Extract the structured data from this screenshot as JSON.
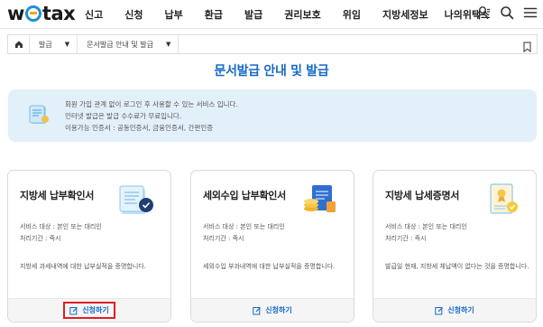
{
  "header": {
    "logo": {
      "prefix": "w",
      "suffix": "tax"
    },
    "nav": [
      "신고",
      "신청",
      "납부",
      "환급",
      "발급",
      "권리보호",
      "위임",
      "지방세정보",
      "나의위택스"
    ],
    "icons": [
      "user-icon",
      "search-icon",
      "menu-icon"
    ]
  },
  "breadcrumb": {
    "items": [
      "발급",
      "문서발급 안내 및 발급"
    ]
  },
  "page_title": "문서발급 안내 및 발급",
  "info": {
    "lines": [
      "회원 가입 관계 없이 로그인 후 사용할 수 있는 서비스 입니다.",
      "인터넷 발급은 발급 수수료가 무료입니다.",
      "이용가능 인증서 : 공동인증서, 금융인증서, 간편인증"
    ]
  },
  "cards": [
    {
      "title": "지방세 납부확인서",
      "meta": [
        "서비스 대상 : 본인 또는 대리인",
        "처리기간 : 즉시"
      ],
      "desc": "지방세 과세내역에 대한 납부실적을 증명합니다.",
      "button": "신청하기",
      "icon": "document-check-icon"
    },
    {
      "title": "세외수입 납부확인서",
      "meta": [
        "서비스 대상 : 본인 또는 대리인",
        "처리기간 : 즉시"
      ],
      "desc": "세외수입 부과내역에 대한 납부실적을 증명합니다.",
      "button": "신청하기",
      "icon": "document-coins-icon"
    },
    {
      "title": "지방세 납세증명서",
      "meta": [
        "서비스 대상 : 본인 또는 대리인",
        "처리기간 : 즉시"
      ],
      "desc": "발급일 현재, 지방세 체납액이 없다는 것을 증명합니다.",
      "button": "신청하기",
      "icon": "certificate-badge-icon"
    }
  ],
  "colors": {
    "accent": "#1569c7",
    "logo_ring": "#1e8fd8",
    "info_bg": "#e2f0fa",
    "highlight": "#e02020"
  }
}
